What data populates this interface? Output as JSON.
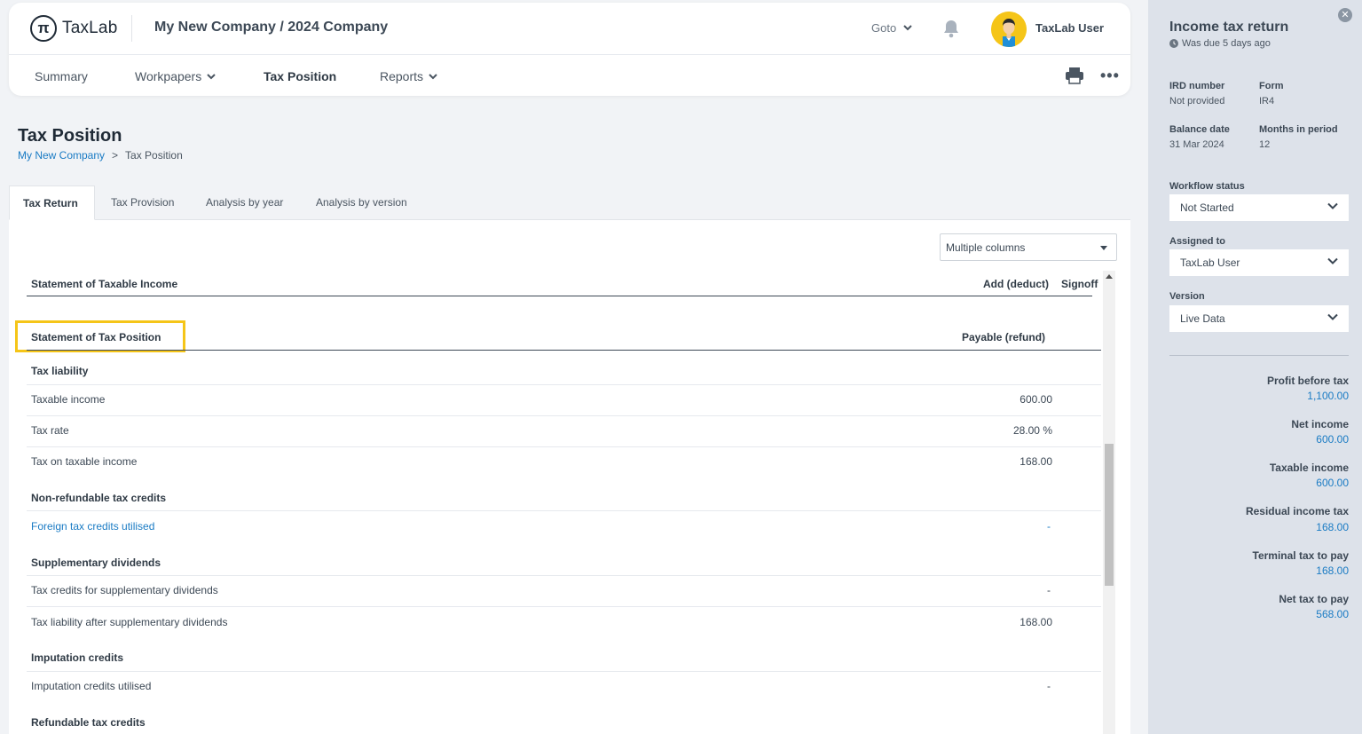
{
  "header": {
    "logo_glyph": "π",
    "logo_text": "TaxLab",
    "company": "My New Company / 2024 Company",
    "goto_label": "Goto",
    "username": "TaxLab User"
  },
  "nav": {
    "items": [
      {
        "label": "Summary"
      },
      {
        "label": "Workpapers"
      },
      {
        "label": "Tax Position"
      },
      {
        "label": "Reports"
      }
    ],
    "more_label": "•••"
  },
  "page": {
    "title": "Tax Position",
    "breadcrumb": {
      "parent": "My New Company",
      "separator": ">",
      "current": "Tax Position"
    }
  },
  "tabs": [
    {
      "label": "Tax Return"
    },
    {
      "label": "Tax Provision"
    },
    {
      "label": "Analysis by year"
    },
    {
      "label": "Analysis by version"
    }
  ],
  "columns_select": {
    "value": "Multiple columns"
  },
  "statement_income": {
    "title": "Statement of Taxable Income",
    "col_add": "Add (deduct)",
    "col_signoff": "Signoff"
  },
  "statement_position": {
    "title": "Statement of Tax Position",
    "col_payable": "Payable (refund)",
    "sections": {
      "tax_liability": "Tax liability",
      "non_refundable": "Non-refundable tax credits",
      "supplementary": "Supplementary dividends",
      "imputation": "Imputation credits",
      "refundable": "Refundable tax credits"
    },
    "rows": {
      "taxable_income": {
        "label": "Taxable income",
        "value": "600.00"
      },
      "tax_rate": {
        "label": "Tax rate",
        "value": "28.00 %"
      },
      "tax_on_income": {
        "label": "Tax on taxable income",
        "value": "168.00"
      },
      "foreign_credits": {
        "label": "Foreign tax credits utilised",
        "value": "-"
      },
      "supp_credits": {
        "label": "Tax credits for supplementary dividends",
        "value": "-"
      },
      "liability_after": {
        "label": "Tax liability after supplementary dividends",
        "value": "168.00"
      },
      "imputation_utilised": {
        "label": "Imputation credits utilised",
        "value": "-"
      }
    }
  },
  "sidebar": {
    "close_label": "✕",
    "title": "Income tax return",
    "due_text": "Was due 5 days ago",
    "ird_label": "IRD number",
    "ird_value": "Not provided",
    "form_label": "Form",
    "form_value": "IR4",
    "balance_label": "Balance date",
    "balance_value": "31 Mar 2024",
    "months_label": "Months in period",
    "months_value": "12",
    "workflow_label": "Workflow status",
    "workflow_value": "Not Started",
    "assigned_label": "Assigned to",
    "assigned_value": "TaxLab User",
    "version_label": "Version",
    "version_value": "Live Data",
    "metrics": {
      "profit_before_tax": {
        "label": "Profit before tax",
        "value": "1,100.00"
      },
      "net_income": {
        "label": "Net income",
        "value": "600.00"
      },
      "taxable_income": {
        "label": "Taxable income",
        "value": "600.00"
      },
      "residual_tax": {
        "label": "Residual income tax",
        "value": "168.00"
      },
      "terminal_tax": {
        "label": "Terminal tax to pay",
        "value": "168.00"
      },
      "net_tax": {
        "label": "Net tax to pay",
        "value": "568.00"
      }
    }
  },
  "colors": {
    "accent": "#1a7bc4",
    "highlight": "#f5c518",
    "sidebar_bg": "#dde2ea"
  }
}
